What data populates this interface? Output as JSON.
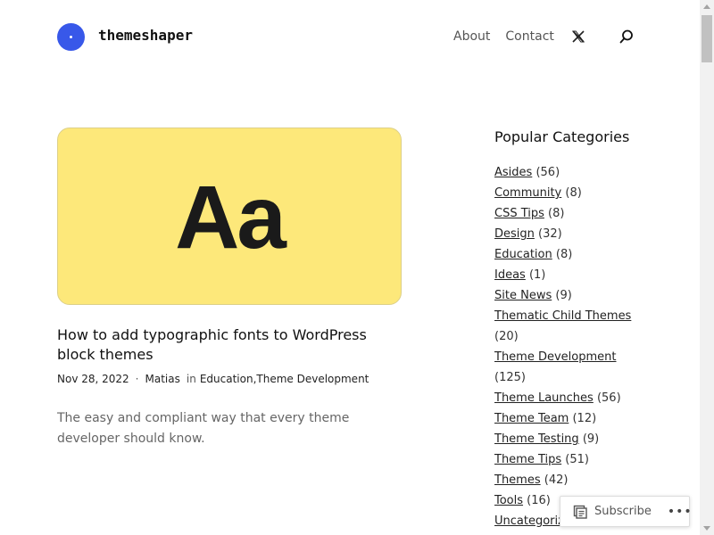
{
  "header": {
    "site_title": "themeshaper",
    "nav": {
      "about": "About",
      "contact": "Contact"
    },
    "icons": {
      "social": "x-icon",
      "search": "search-icon"
    },
    "logo_color": "#3858e9"
  },
  "post": {
    "image_text": "Aa",
    "image_bg": "#fde87a",
    "title": "How to add typographic fonts to WordPress block themes",
    "date": "Nov 28, 2022",
    "separator": "·",
    "author": "Matias",
    "in_label": "in",
    "categories": [
      "Education",
      "Theme Development"
    ],
    "category_sep": ", ",
    "excerpt": "The easy and compliant way that every theme developer should know."
  },
  "sidebar": {
    "title": "Popular Categories",
    "categories": [
      {
        "name": "Asides",
        "count": "(56)"
      },
      {
        "name": "Community",
        "count": "(8)"
      },
      {
        "name": "CSS Tips",
        "count": "(8)"
      },
      {
        "name": "Design",
        "count": "(32)"
      },
      {
        "name": "Education",
        "count": "(8)"
      },
      {
        "name": "Ideas",
        "count": "(1)"
      },
      {
        "name": "Site News",
        "count": "(9)"
      },
      {
        "name": "Thematic Child Themes",
        "count": "(20)"
      },
      {
        "name": "Theme Development",
        "count": "(125)"
      },
      {
        "name": "Theme Launches",
        "count": "(56)"
      },
      {
        "name": "Theme Team",
        "count": "(12)"
      },
      {
        "name": "Theme Testing",
        "count": "(9)"
      },
      {
        "name": "Theme Tips",
        "count": "(51)"
      },
      {
        "name": "Themes",
        "count": "(42)"
      },
      {
        "name": "Tools",
        "count": "(16)"
      },
      {
        "name": "Uncategorized",
        "count": ""
      }
    ]
  },
  "subscribe": {
    "label": "Subscribe",
    "more": "•••",
    "icons": {
      "reader": "reader-icon",
      "more": "more-icon"
    }
  }
}
